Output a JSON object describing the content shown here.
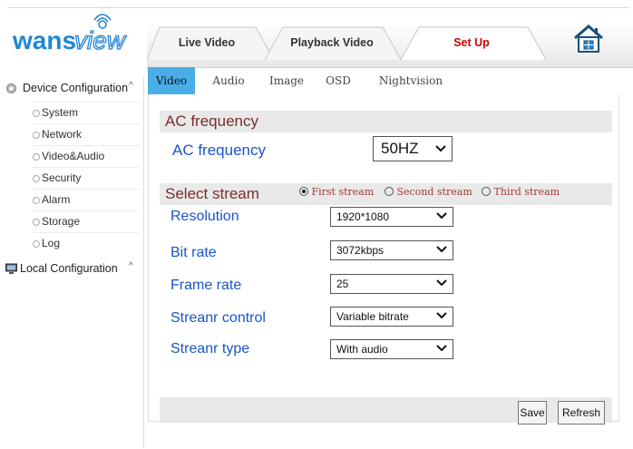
{
  "brand": {
    "logo_text": "wanscview",
    "accent": "#1e86d6"
  },
  "nav": {
    "tabs": [
      {
        "label": "Live Video",
        "active": false
      },
      {
        "label": "Playback Video",
        "active": false
      },
      {
        "label": "Set Up",
        "active": true
      }
    ],
    "home_icon": "home-icon",
    "active_color": "#d10000"
  },
  "sidebar": {
    "device_config": {
      "label": "Device Configuration",
      "icon": "gear-icon"
    },
    "items": [
      {
        "label": "System"
      },
      {
        "label": "Network"
      },
      {
        "label": "Video&Audio"
      },
      {
        "label": "Security"
      },
      {
        "label": "Alarm"
      },
      {
        "label": "Storage"
      },
      {
        "label": "Log"
      }
    ],
    "local_config": {
      "label": "Local Configuration",
      "icon": "computer-icon"
    }
  },
  "subtabs": [
    {
      "label": "Video",
      "active": true
    },
    {
      "label": "Audio",
      "active": false
    },
    {
      "label": "Image",
      "active": false
    },
    {
      "label": "OSD",
      "active": false
    },
    {
      "label": "Nightvision",
      "active": false
    }
  ],
  "ac_section": {
    "title": "AC frequency",
    "label": "AC frequency",
    "value": "50HZ"
  },
  "stream_section": {
    "title": "Select stream",
    "radios": [
      {
        "label": "First stream",
        "selected": true
      },
      {
        "label": "Second stream",
        "selected": false
      },
      {
        "label": "Third stream",
        "selected": false
      }
    ],
    "fields": [
      {
        "label": "Resolution",
        "value": "1920*1080"
      },
      {
        "label": "Bit rate",
        "value": "3072kbps"
      },
      {
        "label": "Frame rate",
        "value": "25"
      },
      {
        "label": "Streanr control",
        "value": "Variable bitrate"
      },
      {
        "label": "Streanr type",
        "value": "With audio"
      }
    ]
  },
  "buttons": {
    "save": "Save",
    "refresh": "Refresh"
  }
}
